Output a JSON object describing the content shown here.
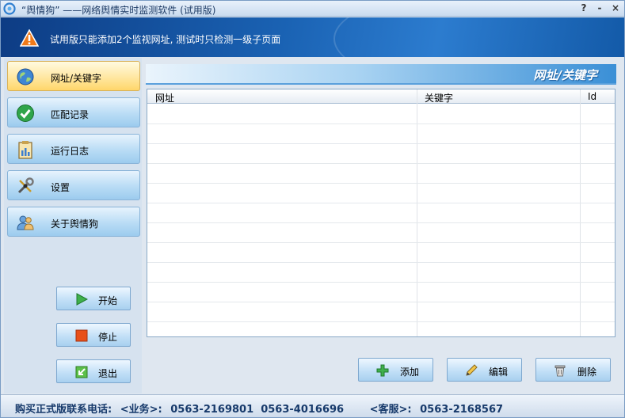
{
  "window": {
    "title": "“舆情狗” ——网络舆情实时监测软件 (试用版)",
    "help_label": "?",
    "minimize_label": "-",
    "close_label": "×"
  },
  "banner": {
    "notice": "试用版只能添加2个监视网址, 测试时只检测一级子页面"
  },
  "nav": {
    "items": [
      {
        "label": "网址/关键字",
        "icon": "globe-icon",
        "active": true
      },
      {
        "label": "匹配记录",
        "icon": "check-icon",
        "active": false
      },
      {
        "label": "运行日志",
        "icon": "clipboard-icon",
        "active": false
      },
      {
        "label": "设置",
        "icon": "tools-icon",
        "active": false
      },
      {
        "label": "关于舆情狗",
        "icon": "users-icon",
        "active": false
      }
    ],
    "controls": {
      "start_label": "开始",
      "stop_label": "停止",
      "exit_label": "退出"
    }
  },
  "panel": {
    "title": "网址/关键字",
    "columns": [
      "网址",
      "关键字",
      "Id"
    ],
    "rows": [],
    "add_label": "添加",
    "edit_label": "编辑",
    "delete_label": "删除"
  },
  "footer": {
    "purchase_label": "购买正式版联系电话:",
    "sales_label": "<业务>:",
    "sales_phones": "0563-2169801  0563-4016696",
    "support_label": "<客服>:",
    "support_phone": "0563-2168567"
  },
  "colors": {
    "banner": "#1a62b3",
    "active_nav": "#ffe7a1",
    "nav_item": "#b9dcf5",
    "footer_text": "#173a6b"
  }
}
